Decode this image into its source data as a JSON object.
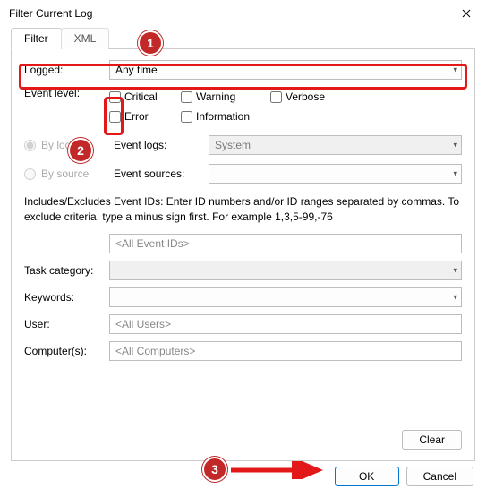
{
  "window": {
    "title": "Filter Current Log"
  },
  "tabs": {
    "filter": "Filter",
    "xml": "XML"
  },
  "form": {
    "logged_label": "Logged:",
    "logged_value": "Any time",
    "eventlevel_label": "Event level:",
    "chk_critical": "Critical",
    "chk_warning": "Warning",
    "chk_verbose": "Verbose",
    "chk_error": "Error",
    "chk_information": "Information",
    "radio_bylog": "By log",
    "radio_bysource": "By source",
    "eventlogs_label": "Event logs:",
    "eventlogs_value": "System",
    "eventsources_label": "Event sources:",
    "eventsources_value": "",
    "help_text": "Includes/Excludes Event IDs: Enter ID numbers and/or ID ranges separated by commas. To exclude criteria, type a minus sign first. For example 1,3,5-99,-76",
    "eventids_value": "<All Event IDs>",
    "taskcat_label": "Task category:",
    "keywords_label": "Keywords:",
    "user_label": "User:",
    "user_value": "<All Users>",
    "computers_label": "Computer(s):",
    "computers_value": "<All Computers>",
    "clear_btn": "Clear"
  },
  "buttons": {
    "ok": "OK",
    "cancel": "Cancel"
  },
  "anno": {
    "b1": "1",
    "b2": "2",
    "b3": "3"
  }
}
